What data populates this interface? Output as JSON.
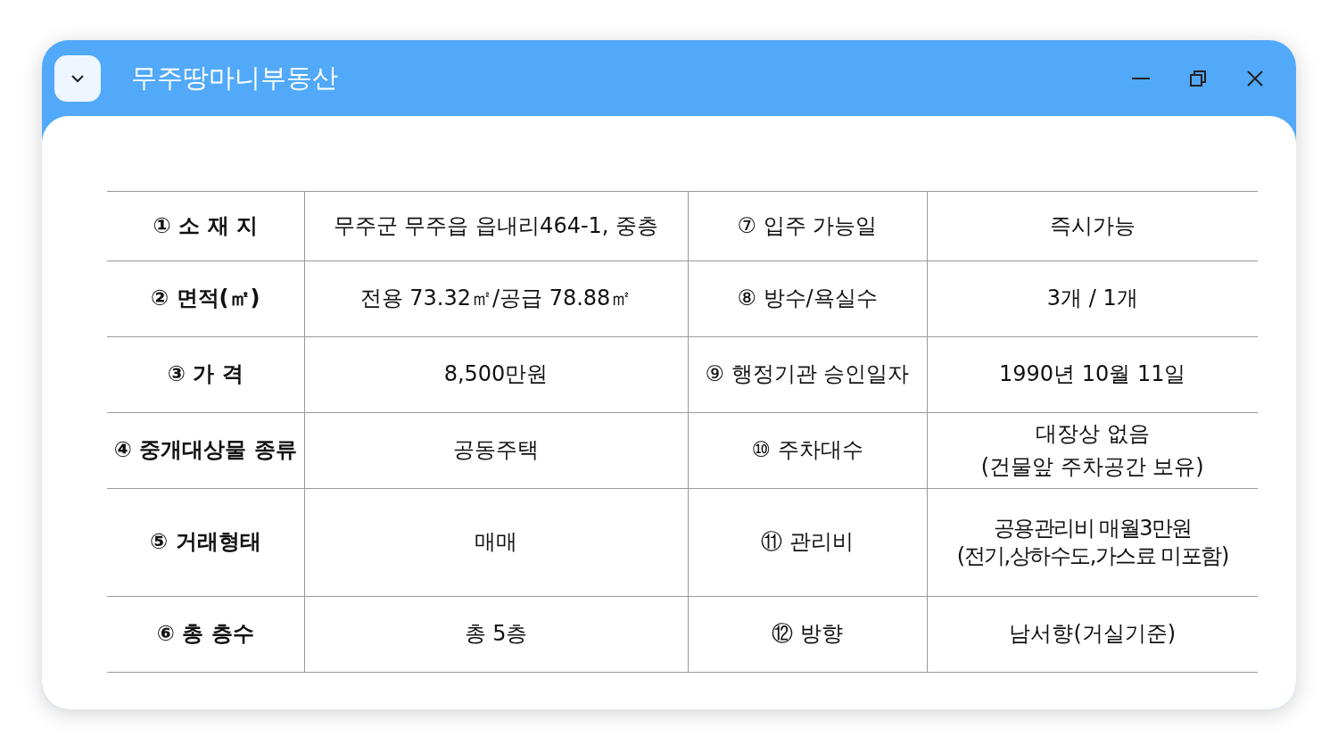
{
  "window": {
    "title": "무주땅마니부동산"
  },
  "table": {
    "rows": [
      {
        "cells": [
          "① 소 재 지",
          "무주군 무주읍 읍내리464-1, 중층",
          "⑦ 입주 가능일",
          "즉시가능"
        ]
      },
      {
        "cells": [
          "② 면적(㎡)",
          "전용 73.32㎡/공급 78.88㎡",
          "⑧ 방수/욕실수",
          "3개  / 1개"
        ]
      },
      {
        "cells": [
          "③ 가 격",
          "8,500만원",
          "⑨ 행정기관 승인일자",
          "1990년 10월 11일"
        ]
      },
      {
        "cells": [
          "④ 중개대상물 종류",
          "공동주택",
          "⑩ 주차대수",
          "대장상 없음\n(건물앞 주차공간 보유)"
        ]
      },
      {
        "cells": [
          "⑤ 거래형태",
          "매매",
          "⑪ 관리비",
          "공용관리비 매월3만원\n(전기,상하수도,가스료 미포함)"
        ]
      },
      {
        "cells": [
          "⑥  총 층수",
          "총 5층",
          "⑫ 방향",
          "남서향(거실기준)"
        ]
      }
    ]
  }
}
